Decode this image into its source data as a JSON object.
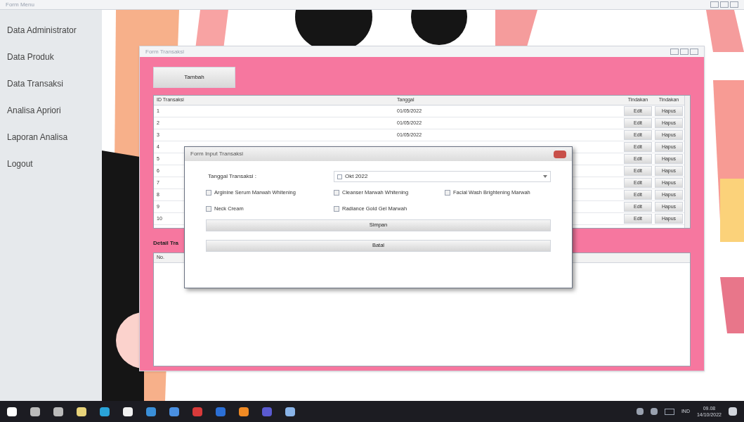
{
  "window": {
    "title": "Form Menu"
  },
  "sidebar": {
    "items": [
      {
        "label": "Data Administrator"
      },
      {
        "label": "Data Produk"
      },
      {
        "label": "Data Transaksi"
      },
      {
        "label": "Analisa Apriori"
      },
      {
        "label": "Laporan Analisa"
      },
      {
        "label": "Logout"
      }
    ]
  },
  "transaction_window": {
    "title": "Form Transaksi",
    "add_button": "Tambah",
    "table": {
      "columns": [
        "ID Transaksi",
        "Tanggal",
        "Tindakan",
        "Tindakan"
      ],
      "rows": [
        {
          "id": "1",
          "date": "01/05/2022",
          "edit": "Edit",
          "delete": "Hapus"
        },
        {
          "id": "2",
          "date": "01/05/2022",
          "edit": "Edit",
          "delete": "Hapus"
        },
        {
          "id": "3",
          "date": "01/05/2022",
          "edit": "Edit",
          "delete": "Hapus"
        },
        {
          "id": "4",
          "edit": "Edit",
          "delete": "Hapus"
        },
        {
          "id": "5",
          "edit": "Edit",
          "delete": "Hapus"
        },
        {
          "id": "6",
          "edit": "Edit",
          "delete": "Hapus"
        },
        {
          "id": "7",
          "edit": "Edit",
          "delete": "Hapus"
        },
        {
          "id": "8",
          "edit": "Edit",
          "delete": "Hapus"
        },
        {
          "id": "9",
          "edit": "Edit",
          "delete": "Hapus"
        },
        {
          "id": "10",
          "edit": "Edit",
          "delete": "Hapus"
        }
      ]
    },
    "detail": {
      "title": "Detail Tra",
      "columns": [
        "No."
      ]
    }
  },
  "dialog": {
    "title": "Form Input Transaksi",
    "date_label": "Tanggal Transaksi :",
    "date_value": "Okt 2022",
    "products": [
      {
        "label": "Arginine Serum Marwah Whitening",
        "checked": false
      },
      {
        "label": "Cleanser Marwah Whitening",
        "checked": false
      },
      {
        "label": "Facial Wash Brightening Marwah",
        "checked": false
      },
      {
        "label": "Neck Cream",
        "checked": false
      },
      {
        "label": "Radiance Gold Gel Marwah",
        "checked": false
      }
    ],
    "buttons": [
      "Simpan",
      "Batal"
    ]
  },
  "taskbar": {
    "language": "IND",
    "time": "09.08",
    "date": "14/10/2022"
  }
}
